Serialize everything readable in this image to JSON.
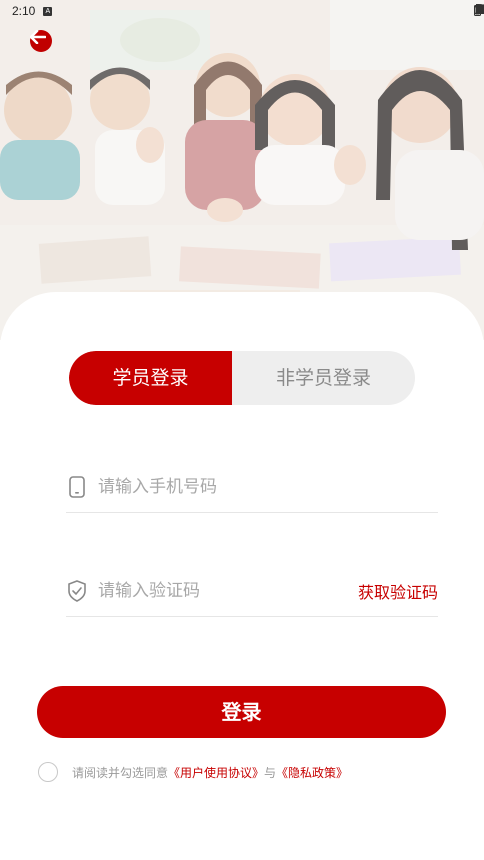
{
  "status_bar": {
    "time": "2:10",
    "notification_badge": "A"
  },
  "hero": {
    "image": "children-classroom-photo"
  },
  "tabs": [
    {
      "label": "学员登录",
      "active": true
    },
    {
      "label": "非学员登录",
      "active": false
    }
  ],
  "form": {
    "phone_placeholder": "请输入手机号码",
    "code_placeholder": "请输入验证码",
    "get_code_label": "获取验证码"
  },
  "login_button": "登录",
  "agreement": {
    "prefix": "请阅读并勾选同意",
    "user_agreement": "《用户使用协议》",
    "conjunction": "与",
    "privacy_policy": "《隐私政策》"
  },
  "colors": {
    "accent": "#c70000",
    "tab_inactive_bg": "#eeeeee",
    "placeholder": "#a8a8a8"
  },
  "icons": [
    "back-arrow-icon",
    "phone-icon",
    "shield-check-icon",
    "wifi-icon",
    "signal-icon",
    "battery-icon"
  ]
}
